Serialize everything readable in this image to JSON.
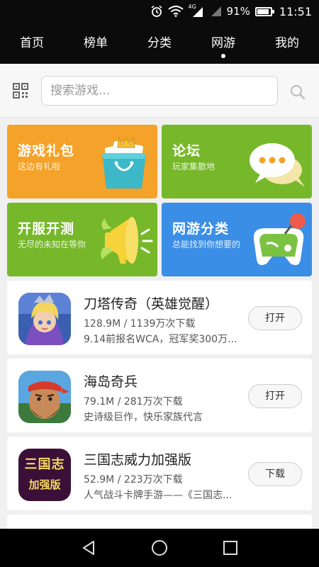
{
  "status_bar": {
    "network": "4G",
    "battery": "91%",
    "battery_level": 0.91,
    "time": "11:51"
  },
  "tabs": [
    {
      "label": "首页",
      "active": false
    },
    {
      "label": "榜单",
      "active": false
    },
    {
      "label": "分类",
      "active": false
    },
    {
      "label": "网游",
      "active": true
    },
    {
      "label": "我的",
      "active": false
    }
  ],
  "search": {
    "placeholder": "搜索游戏..."
  },
  "tiles": [
    {
      "title": "游戏礼包",
      "subtitle": "这边有礼啦",
      "color": "#f4a22a",
      "icon": "gift-bag-icon"
    },
    {
      "title": "论坛",
      "subtitle": "玩家集散地",
      "color": "#76b82a",
      "icon": "chat-bubble-icon"
    },
    {
      "title": "开服开测",
      "subtitle": "无尽的未知在等你",
      "color": "#76b82a",
      "icon": "megaphone-icon"
    },
    {
      "title": "网游分类",
      "subtitle": "总能找到你想要的",
      "color": "#3a8ee6",
      "icon": "gamepad-icon"
    }
  ],
  "apps": [
    {
      "name": "刀塔传奇（英雄觉醒）",
      "meta": "128.9M / 1139万次下载",
      "desc": "9.14前报名WCA，冠军奖300万...",
      "button": "打开"
    },
    {
      "name": "海岛奇兵",
      "meta": "79.1M / 281万次下载",
      "desc": "史诗级巨作，快乐家族代言",
      "button": "打开"
    },
    {
      "name": "三国志威力加强版",
      "meta": "52.9M / 223万次下载",
      "desc": "人气战斗卡牌手游——《三国志...",
      "button": "下载"
    }
  ],
  "app_icon_texts": {
    "sanguo_line1": "三国志",
    "sanguo_line2": "加强版"
  }
}
